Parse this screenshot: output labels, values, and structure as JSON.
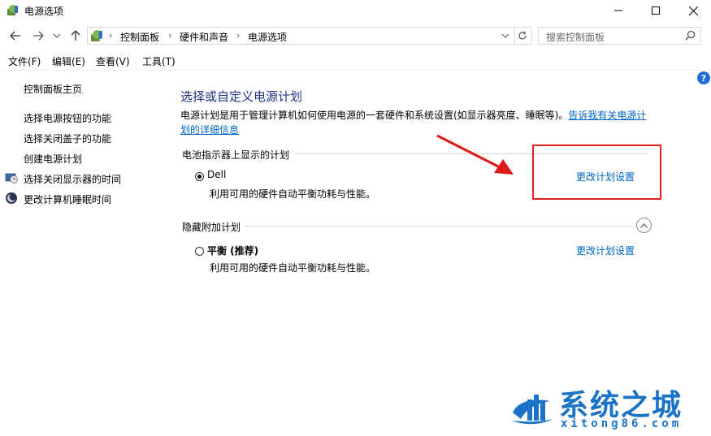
{
  "window": {
    "title": "电源选项"
  },
  "nav": {
    "breadcrumbs": [
      "控制面板",
      "硬件和声音",
      "电源选项"
    ],
    "search_placeholder": "搜索控制面板"
  },
  "menu": [
    "文件(F)",
    "编辑(E)",
    "查看(V)",
    "工具(T)"
  ],
  "sidebar": {
    "home": "控制面板主页",
    "items": [
      {
        "label": "选择电源按钮的功能",
        "icon": ""
      },
      {
        "label": "选择关闭盖子的功能",
        "icon": ""
      },
      {
        "label": "创建电源计划",
        "icon": ""
      },
      {
        "label": "选择关闭显示器的时间",
        "icon": "display-clock-icon"
      },
      {
        "label": "更改计算机睡眠时间",
        "icon": "moon-icon"
      }
    ]
  },
  "main": {
    "title": "选择或自定义电源计划",
    "description": "电源计划是用于管理计算机如何使用电源的一套硬件和系统设置(如显示器亮度、睡眠等)。",
    "description_link_line1": "告诉我有关电源计",
    "description_link_line2": "划的详细信息",
    "section_battery": "电池指示器上显示的计划",
    "section_hidden": "隐藏附加计划",
    "plans": [
      {
        "name": "Dell",
        "desc": "利用可用的硬件自动平衡功耗与性能。",
        "link": "更改计划设置",
        "selected": true
      },
      {
        "name": "平衡 (推荐)",
        "desc": "利用可用的硬件自动平衡功耗与性能。",
        "link": "更改计划设置",
        "selected": false
      }
    ]
  },
  "watermark": {
    "text": "系统之城",
    "sub": "xitong86.com"
  },
  "colors": {
    "accent": "#0066cc",
    "title": "#1e3287",
    "highlight": "#e02020",
    "watermark": "#1b73c8"
  }
}
